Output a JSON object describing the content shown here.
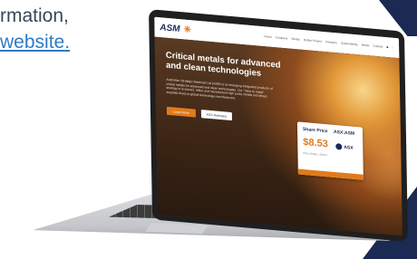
{
  "intro": {
    "line1": "rmation,",
    "line2": "website."
  },
  "site": {
    "logo": "ASM",
    "nav": [
      "Home",
      "Company",
      "Metals",
      "Dubbo Project",
      "Investors",
      "Sustainability",
      "Media",
      "Contact"
    ],
    "hero_title_1": "Critical metals for advanced",
    "hero_title_2": "and clean technologies",
    "hero_text": "Australian Strategic Materials Ltd (ASM) is an emerging integrated producer of critical metals for advanced and clean technologies. Our \"mine to metal\" strategy is to extract, refine and manufacture high purity metals and alloys, supplied direct to global technology manufacturers.",
    "learn_more": "Learn More",
    "asx_releases": "ASX Releases"
  },
  "share_card": {
    "label": "Share Price",
    "ticker": "ASX:ASM",
    "price": "$8.53",
    "note": "Price Delay ~20min",
    "exchange": "ASX"
  },
  "colors": {
    "navy": "#1a2a52",
    "orange": "#e07b1b",
    "link_blue": "#2f7cc4"
  }
}
